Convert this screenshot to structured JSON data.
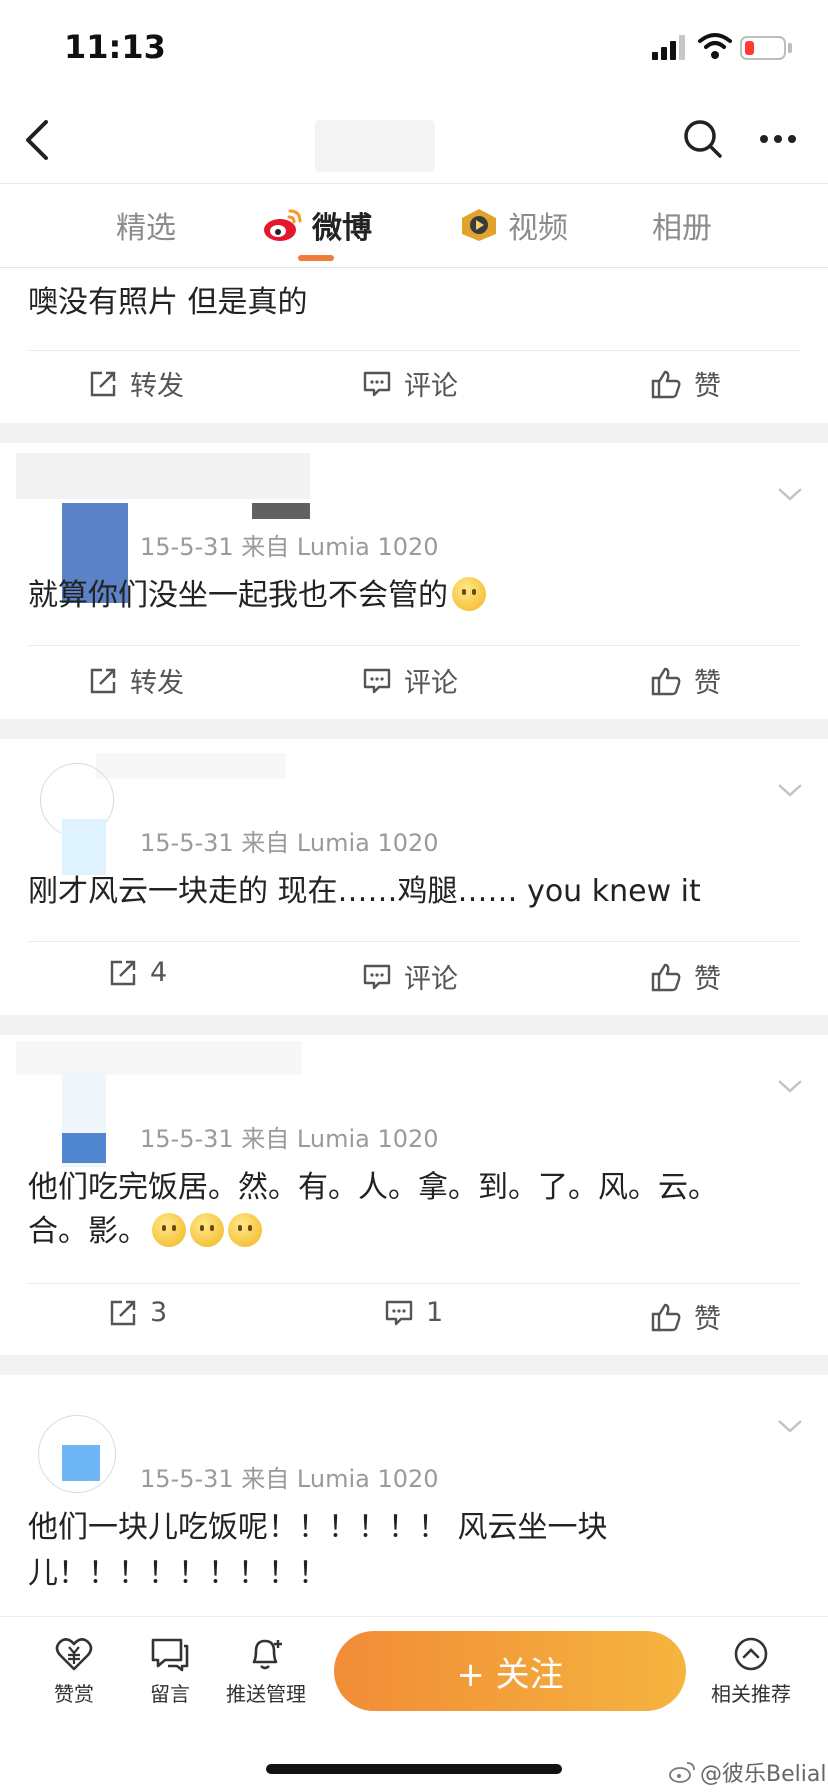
{
  "status_bar": {
    "time": "11:13"
  },
  "tabs": [
    {
      "label": "精选",
      "active": false
    },
    {
      "label": "微博",
      "active": true
    },
    {
      "label": "视频",
      "active": false
    },
    {
      "label": "相册",
      "active": false
    }
  ],
  "posts": [
    {
      "text": "噢没有照片 但是真的",
      "actions": {
        "repost": "转发",
        "comment": "评论",
        "like": "赞"
      }
    },
    {
      "meta": "15-5-31  来自 Lumia 1020",
      "text": "就算你们没坐一起我也不会管的",
      "actions": {
        "repost": "转发",
        "comment": "评论",
        "like": "赞"
      }
    },
    {
      "meta": "15-5-31  来自 Lumia 1020",
      "text": "刚才风云一块走的 现在……鸡腿…… you knew it",
      "actions": {
        "repost": "4",
        "comment": "评论",
        "like": "赞"
      }
    },
    {
      "meta": "15-5-31  来自 Lumia 1020",
      "text_line1": "他们吃完饭居。然。有。人。拿。到。了。风。云。",
      "text_line2": "合。影。",
      "actions": {
        "repost": "3",
        "comment": "1",
        "like": "赞"
      }
    },
    {
      "meta": "15-5-31  来自 Lumia 1020",
      "text_line1": "他们一块儿吃饭呢！！！！！！ 风云坐一块",
      "text_line2": "儿！！！！！！！！！"
    }
  ],
  "bottom_bar": {
    "reward": "赞赏",
    "message": "留言",
    "push": "推送管理",
    "follow": "+ 关注",
    "related": "相关推荐"
  },
  "watermark": "@彼乐Belial",
  "colors": {
    "accent": "#f07b3a",
    "follow_start": "#f18c37",
    "follow_end": "#f5b43f"
  }
}
